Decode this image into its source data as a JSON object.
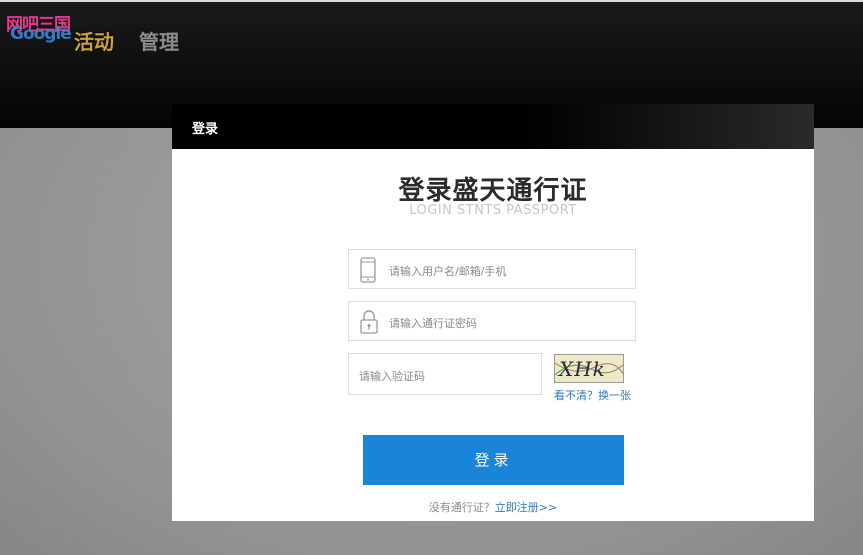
{
  "header": {
    "logo_brand_top": "网吧三国",
    "logo_brand_bottom": "Google",
    "logo_activity": "活动",
    "logo_manage": "管理"
  },
  "modal": {
    "title": "登录",
    "heading": "登录盛天通行证",
    "subheading": "LOGIN STNTS PASSPORT"
  },
  "form": {
    "username_placeholder": "请输入用户名/邮箱/手机",
    "password_placeholder": "请输入通行证密码",
    "captcha_placeholder": "请输入验证码",
    "captcha_text": "XHk",
    "captcha_refresh": "看不清？换一张",
    "submit_label": "登录"
  },
  "footer": {
    "no_account": "没有通行证？",
    "register_link": "立即注册>>"
  },
  "colors": {
    "accent": "#1a84d8",
    "link": "#2e7bc4"
  }
}
